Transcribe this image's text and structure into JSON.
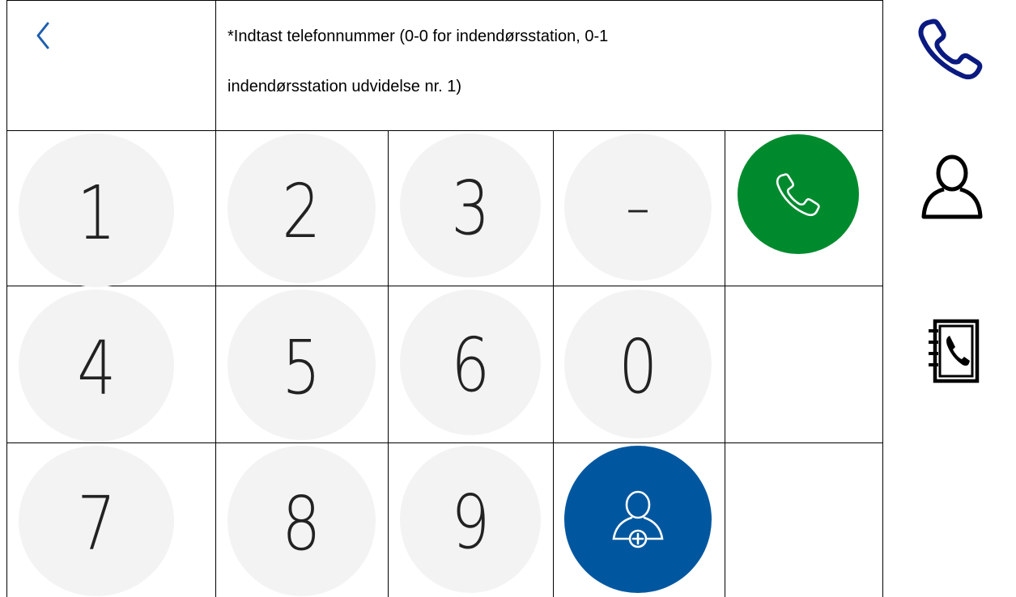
{
  "header": {
    "prompt_line1": "*Indtast telefonnummer (0-0 for indendørsstation, 0-1",
    "prompt_line2": "indendørsstation udvidelse nr. 1)"
  },
  "keypad": {
    "k1": "1",
    "k2": "2",
    "k3": "3",
    "dash": "–",
    "k4": "4",
    "k5": "5",
    "k6": "6",
    "k0": "0",
    "k7": "7",
    "k8": "8",
    "k9": "9"
  },
  "icons": {
    "back": "chevron-left-icon",
    "call": "phone-icon",
    "add_contact": "add-contact-icon",
    "side_dial": "phone-icon",
    "side_contacts": "person-icon",
    "side_phonebook": "phonebook-icon"
  },
  "colors": {
    "call_green": "#008a2e",
    "contact_blue": "#0057a0",
    "key_gray": "#f3f3f3",
    "active_tab": "#0a1a80"
  }
}
